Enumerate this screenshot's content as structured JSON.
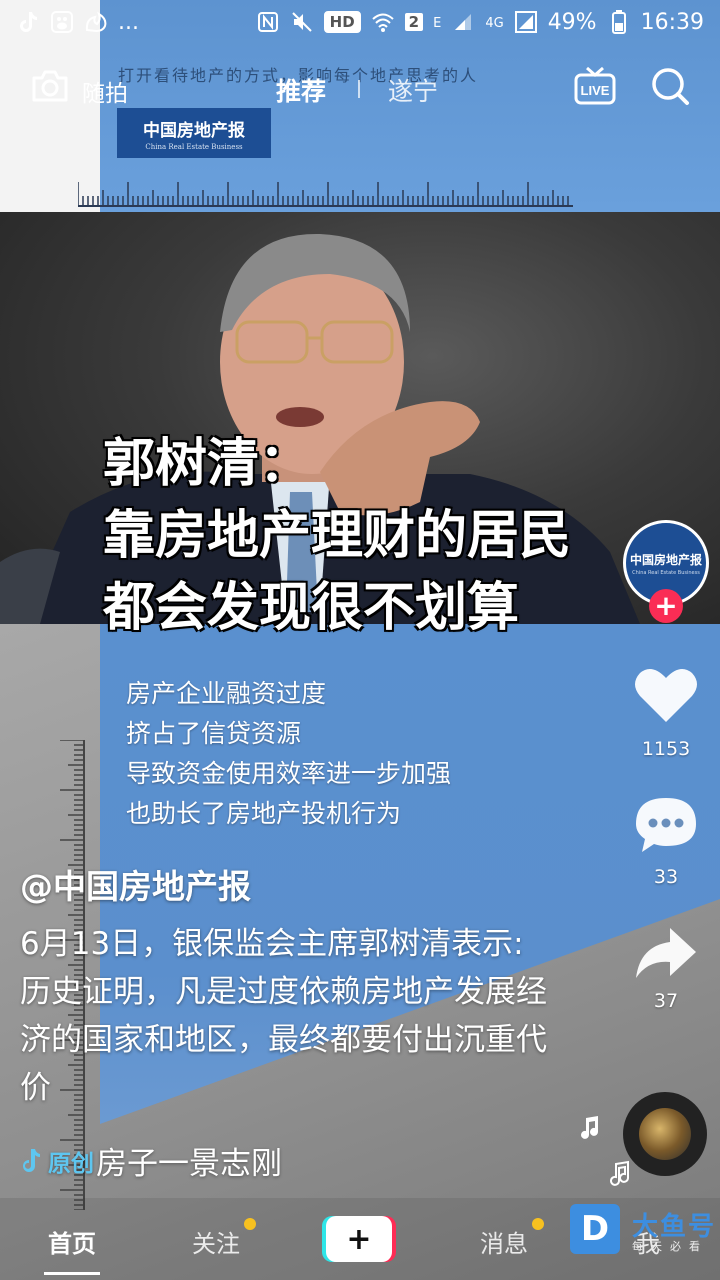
{
  "status_bar": {
    "left_dots": "...",
    "hd": "HD",
    "sim": "2",
    "net_e": "E",
    "net_4g": "4G",
    "battery": "49%",
    "time": "16:39"
  },
  "top_nav": {
    "camera_label": "随拍",
    "tab_recommend": "推荐",
    "tab_city": "遂宁",
    "live_label": "LIVE"
  },
  "video": {
    "tagline": "打开看待地产的方式，影响每个地产思考的人",
    "logo_cn": "中国房地产报",
    "logo_en": "China Real Estate Business",
    "headline": [
      "郭树清：",
      "靠房地产理财的居民",
      "都会发现很不划算"
    ],
    "subtitles": [
      "房产企业融资过度",
      "挤占了信贷资源",
      "导致资金使用效率进一步加强",
      "也助长了房地产投机行为"
    ]
  },
  "rail": {
    "avatar_text": "中国房地产报",
    "avatar_sub": "China Real Estate Business",
    "follow": "+",
    "likes": "1153",
    "comments": "33",
    "shares": "37"
  },
  "post": {
    "author": "@中国房地产报",
    "description": "6月13日，银保监会主席郭树清表示: 历史证明，凡是过度依赖房地产发展经济的国家和地区，最终都要付出沉重代价",
    "music_tag": "原创",
    "music_name": "房子一景志刚"
  },
  "bottom_nav": {
    "home": "首页",
    "follow": "关注",
    "plus": "+",
    "messages": "消息",
    "me": "我"
  },
  "watermark": {
    "logo_letter": "D",
    "title": "大鱼号",
    "slogan": "每天必看"
  },
  "colors": {
    "accent_red": "#fe2c55",
    "accent_cyan": "#2ee6e8",
    "notif_dot": "#f7c120",
    "brand_blue": "#1d4e94"
  }
}
